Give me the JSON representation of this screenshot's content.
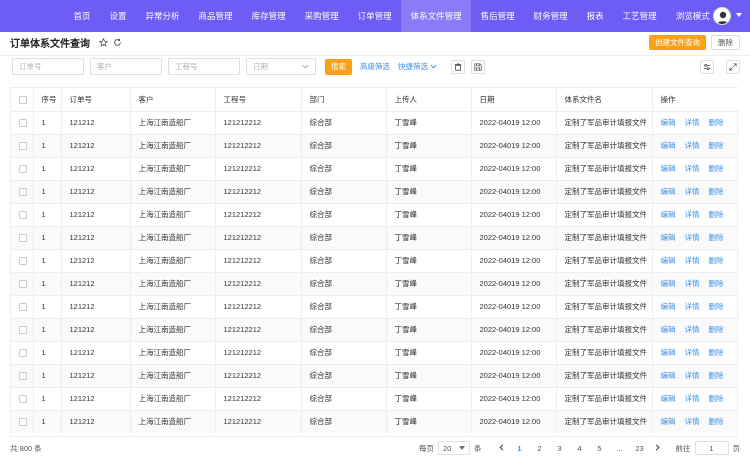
{
  "nav": {
    "items": [
      "首页",
      "设置",
      "异常分析",
      "商品管理",
      "库存管理",
      "采购管理",
      "订单管理",
      "体系文件管理",
      "售后管理",
      "财务管理",
      "报表",
      "工艺管理",
      "浏览模式"
    ],
    "active_index": 7,
    "color": "#6e5df5"
  },
  "page": {
    "title": "订单体系文件查询",
    "create_label": "创建文件查询",
    "delete_label": "删除"
  },
  "filters": {
    "order_placeholder": "订单号",
    "customer_placeholder": "客户",
    "project_placeholder": "工程号",
    "date_placeholder": "日期",
    "search_label": "搜索",
    "advanced_label": "高级筛选",
    "quick_label": "快捷筛选"
  },
  "table": {
    "headers": [
      "序号",
      "订单号",
      "客户",
      "工程号",
      "部门",
      "上传人",
      "日期",
      "体系文件名",
      "操作"
    ],
    "rows": [
      [
        "1",
        "121212",
        "上海江南造船厂",
        "121212212",
        "综合部",
        "丁雪峰",
        "2022-04019 12:00",
        "定制了军品审计填报文件"
      ],
      [
        "1",
        "121212",
        "上海江南造船厂",
        "121212212",
        "综合部",
        "丁雪峰",
        "2022-04019 12:00",
        "定制了军品审计填报文件"
      ],
      [
        "1",
        "121212",
        "上海江南造船厂",
        "121212212",
        "综合部",
        "丁雪峰",
        "2022-04019 12:00",
        "定制了军品审计填报文件"
      ],
      [
        "1",
        "121212",
        "上海江南造船厂",
        "121212212",
        "综合部",
        "丁雪峰",
        "2022-04019 12:00",
        "定制了军品审计填报文件"
      ],
      [
        "1",
        "121212",
        "上海江南造船厂",
        "121212212",
        "综合部",
        "丁雪峰",
        "2022-04019 12:00",
        "定制了军品审计填报文件"
      ],
      [
        "1",
        "121212",
        "上海江南造船厂",
        "121212212",
        "综合部",
        "丁雪峰",
        "2022-04019 12:00",
        "定制了军品审计填报文件"
      ],
      [
        "1",
        "121212",
        "上海江南造船厂",
        "121212212",
        "综合部",
        "丁雪峰",
        "2022-04019 12:00",
        "定制了军品审计填报文件"
      ],
      [
        "1",
        "121212",
        "上海江南造船厂",
        "121212212",
        "综合部",
        "丁雪峰",
        "2022-04019 12:00",
        "定制了军品审计填报文件"
      ],
      [
        "1",
        "121212",
        "上海江南造船厂",
        "121212212",
        "综合部",
        "丁雪峰",
        "2022-04019 12:00",
        "定制了军品审计填报文件"
      ],
      [
        "1",
        "121212",
        "上海江南造船厂",
        "121212212",
        "综合部",
        "丁雪峰",
        "2022-04019 12:00",
        "定制了军品审计填报文件"
      ],
      [
        "1",
        "121212",
        "上海江南造船厂",
        "121212212",
        "综合部",
        "丁雪峰",
        "2022-04019 12:00",
        "定制了军品审计填报文件"
      ],
      [
        "1",
        "121212",
        "上海江南造船厂",
        "121212212",
        "综合部",
        "丁雪峰",
        "2022-04019 12:00",
        "定制了军品审计填报文件"
      ],
      [
        "1",
        "121212",
        "上海江南造船厂",
        "121212212",
        "综合部",
        "丁雪峰",
        "2022-04019 12:00",
        "定制了军品审计填报文件"
      ],
      [
        "1",
        "121212",
        "上海江南造船厂",
        "121212212",
        "综合部",
        "丁雪峰",
        "2022-04019 12:00",
        "定制了军品审计填报文件"
      ]
    ],
    "actions": [
      "编辑",
      "详情",
      "删除"
    ]
  },
  "footer": {
    "total": "共 800 条",
    "per_page_label": "每页",
    "per_page_value": "20",
    "per_page_unit": "条",
    "pages": [
      "1",
      "2",
      "3",
      "4",
      "5",
      "...",
      "23"
    ],
    "current_page": "1",
    "goto_label": "前往",
    "goto_value": "1",
    "goto_unit": "页"
  }
}
